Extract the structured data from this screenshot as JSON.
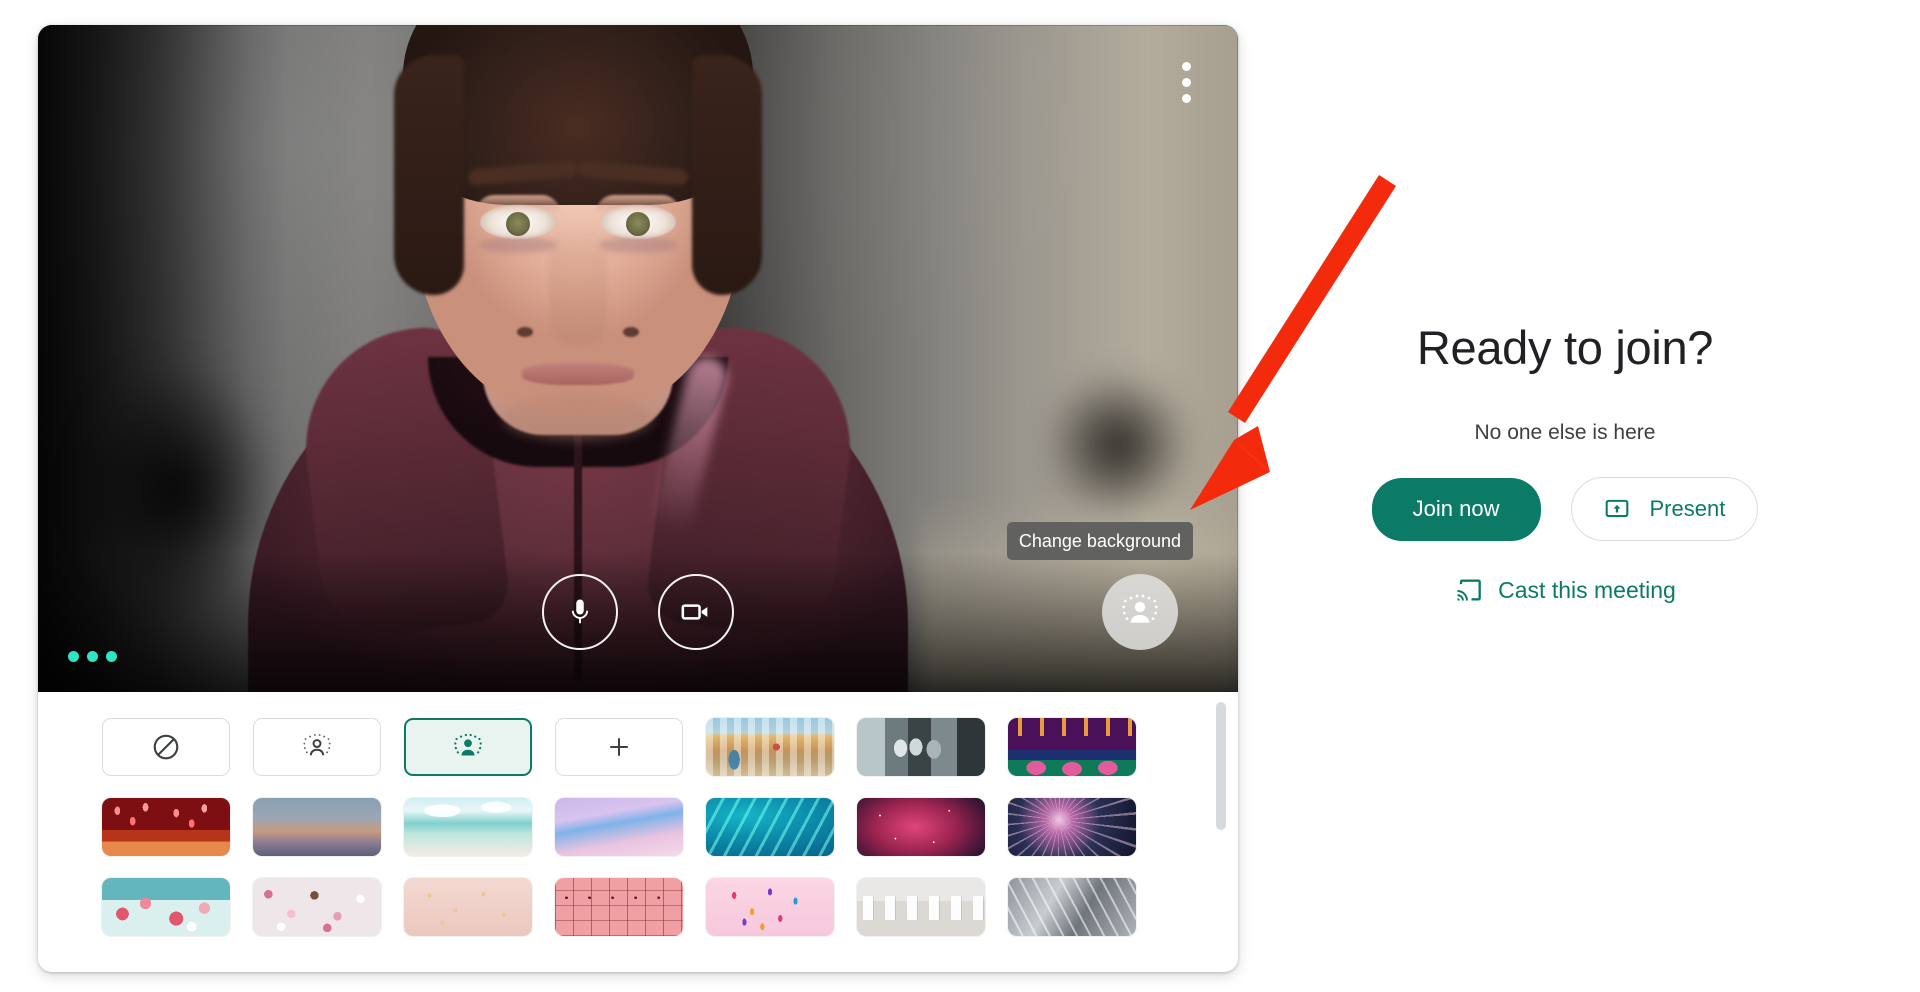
{
  "video": {
    "kebab_menu_name": "More options",
    "tooltip": "Change background",
    "controls": {
      "mic_label": "Turn off microphone",
      "camera_label": "Turn off camera",
      "effects_label": "Apply visual effects"
    }
  },
  "effects_panel": {
    "row1": [
      {
        "type": "button",
        "icon": "no-effect-icon",
        "name": "no-effects"
      },
      {
        "type": "button",
        "icon": "slight-blur-icon",
        "name": "slight-blur"
      },
      {
        "type": "button",
        "icon": "blur-icon",
        "name": "blur-background",
        "selected": true
      },
      {
        "type": "button",
        "icon": "plus-icon",
        "name": "add-background"
      },
      {
        "type": "thumb",
        "art": "t-market",
        "name": "background-market"
      },
      {
        "type": "thumb",
        "art": "t-locks",
        "name": "background-locks"
      },
      {
        "type": "thumb",
        "art": "t-festival",
        "name": "background-festival"
      }
    ],
    "row2": [
      {
        "type": "thumb",
        "art": "t-lanterns",
        "name": "background-lanterns"
      },
      {
        "type": "thumb",
        "art": "t-dusk",
        "name": "background-dusk"
      },
      {
        "type": "thumb",
        "art": "t-beach",
        "name": "background-beach"
      },
      {
        "type": "thumb",
        "art": "t-pastel",
        "name": "background-pastel-sky"
      },
      {
        "type": "thumb",
        "art": "t-water",
        "name": "background-water"
      },
      {
        "type": "thumb",
        "art": "t-nebula",
        "name": "background-nebula"
      },
      {
        "type": "thumb",
        "art": "t-fireworks",
        "name": "background-fireworks"
      }
    ],
    "row3": [
      {
        "type": "thumb",
        "art": "t-blossomsky",
        "name": "background-blossom-sky"
      },
      {
        "type": "thumb",
        "art": "t-blossom2",
        "name": "background-blossoms"
      },
      {
        "type": "thumb",
        "art": "t-confetti-peach",
        "name": "background-peach-confetti"
      },
      {
        "type": "thumb",
        "art": "t-lockers",
        "name": "background-lockers"
      },
      {
        "type": "thumb",
        "art": "t-confetti-pink",
        "name": "background-pink-confetti"
      },
      {
        "type": "thumb",
        "art": "t-gallery",
        "name": "background-gallery"
      },
      {
        "type": "thumb",
        "art": "t-stairs",
        "name": "background-stairs"
      }
    ]
  },
  "join": {
    "title": "Ready to join?",
    "subtitle": "No one else is here",
    "join_now_label": "Join now",
    "present_label": "Present",
    "cast_label": "Cast this meeting",
    "present_icon": "present-to-screen-icon",
    "cast_icon": "cast-icon"
  },
  "annotation": {
    "arrow_color": "#f32a0c",
    "points_to": "Change background"
  },
  "colors": {
    "accent_green": "#0b7b68",
    "selected_bg": "#e9f4f1",
    "tooltip_bg": "#61625f",
    "title_text": "#202124",
    "scrollbar": "#d6dadf",
    "dots_green": "#2ee6c2"
  }
}
